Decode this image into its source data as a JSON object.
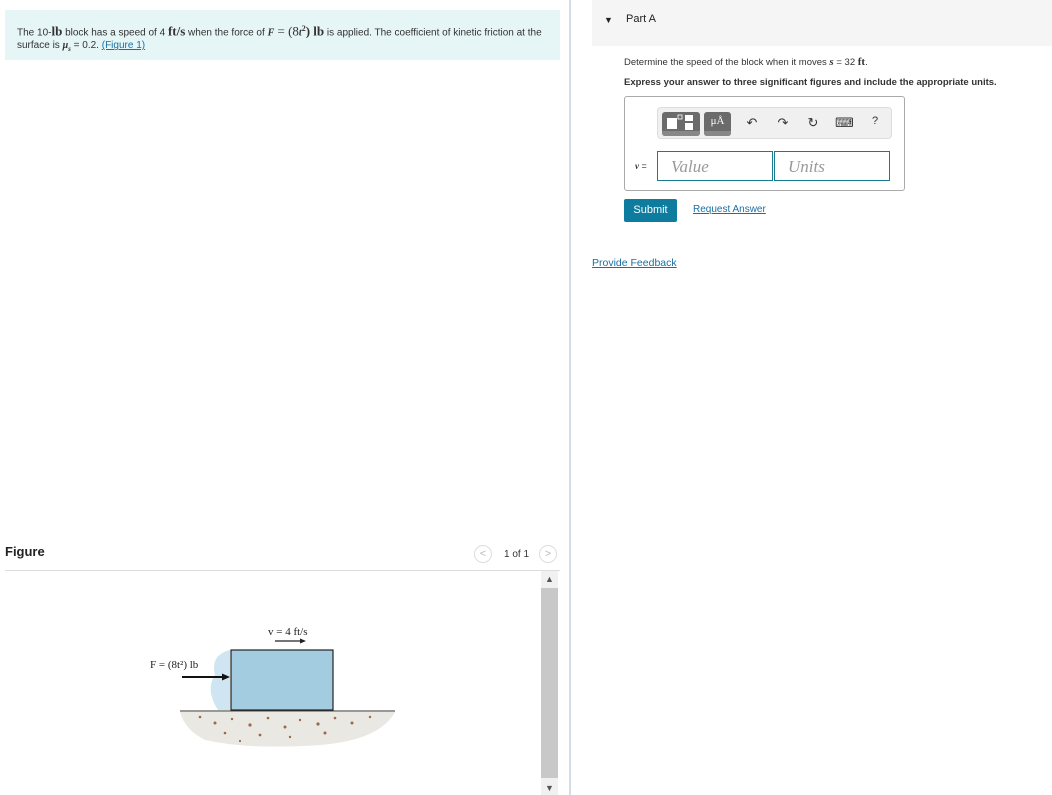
{
  "problem": {
    "t1": "The 10-",
    "lb": "lb",
    "t2": " block has a speed of 4 ",
    "fts": "ft/s",
    "t3": " when the force of ",
    "F": "F",
    "eq": " = (8",
    "t": "t",
    "sq": "2",
    "close": ") lb",
    "t4": " is applied. The coefficient of kinetic friction at the surface is ",
    "mu": "μ",
    "mu_sub": "s",
    "t5": " = 0.2. ",
    "figure_link": "(Figure 1)"
  },
  "part": {
    "title": "Part A",
    "question_pre": "Determine the speed of the block when it moves ",
    "s_var": "s",
    "question_mid": " = 32 ",
    "ft": "ft",
    "question_end": ".",
    "instruction": "Express your answer to three significant figures and include the appropriate units.",
    "toolbar": {
      "units_label": "μÅ",
      "undo": "↶",
      "redo": "↷",
      "reset": "↻",
      "keyboard": "⌨",
      "help": "?"
    },
    "var_label": "v",
    "eq_sign": " =",
    "value_placeholder": "Value",
    "units_placeholder": "Units",
    "submit": "Submit",
    "request_answer": "Request Answer"
  },
  "feedback": "Provide Feedback",
  "figure": {
    "title": "Figure",
    "counter": "1 of 1",
    "prev": "<",
    "next": ">",
    "velocity_label": "v = 4 ft/s",
    "force_label": "F = (8t²) lb"
  },
  "colors": {
    "accent": "#0e7c9e",
    "link": "#1a6fa3",
    "problem_bg": "#e6f5f5",
    "block": "#a3cce0"
  }
}
